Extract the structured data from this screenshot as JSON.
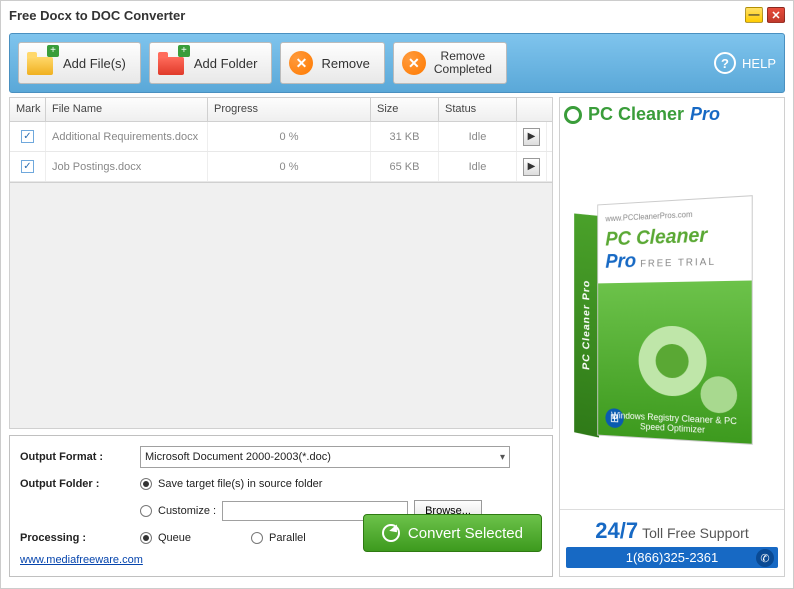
{
  "window": {
    "title": "Free Docx to DOC Converter"
  },
  "toolbar": {
    "add_files": "Add File(s)",
    "add_folder": "Add Folder",
    "remove": "Remove",
    "remove_completed_l1": "Remove",
    "remove_completed_l2": "Completed",
    "help": "HELP"
  },
  "columns": {
    "mark": "Mark",
    "filename": "File Name",
    "progress": "Progress",
    "size": "Size",
    "status": "Status"
  },
  "rows": [
    {
      "name": "Additional Requirements.docx",
      "progress": "0 %",
      "size": "31 KB",
      "status": "Idle"
    },
    {
      "name": "Job Postings.docx",
      "progress": "0 %",
      "size": "65 KB",
      "status": "Idle"
    }
  ],
  "options": {
    "output_format_label": "Output Format :",
    "output_format_value": "Microsoft Document 2000-2003(*.doc)",
    "output_folder_label": "Output Folder :",
    "save_source": "Save target file(s) in source folder",
    "customize": "Customize :",
    "browse": "Browse...",
    "processing_label": "Processing :",
    "queue": "Queue",
    "parallel": "Parallel",
    "convert": "Convert Selected"
  },
  "footer": {
    "link": "www.mediafreeware.com"
  },
  "ad": {
    "brand1": "PC Cleaner",
    "brand2": "Pro",
    "url": "www.PCCleanerPros.com",
    "name1": "PC Cleaner",
    "name2": "Pro",
    "trial": "FREE TRIAL",
    "side": "PC Cleaner Pro",
    "sub": "Windows Registry Cleaner & PC Speed Optimizer",
    "n247": "24/7",
    "toll": "Toll Free Support",
    "phone": "1(866)325-2361"
  }
}
